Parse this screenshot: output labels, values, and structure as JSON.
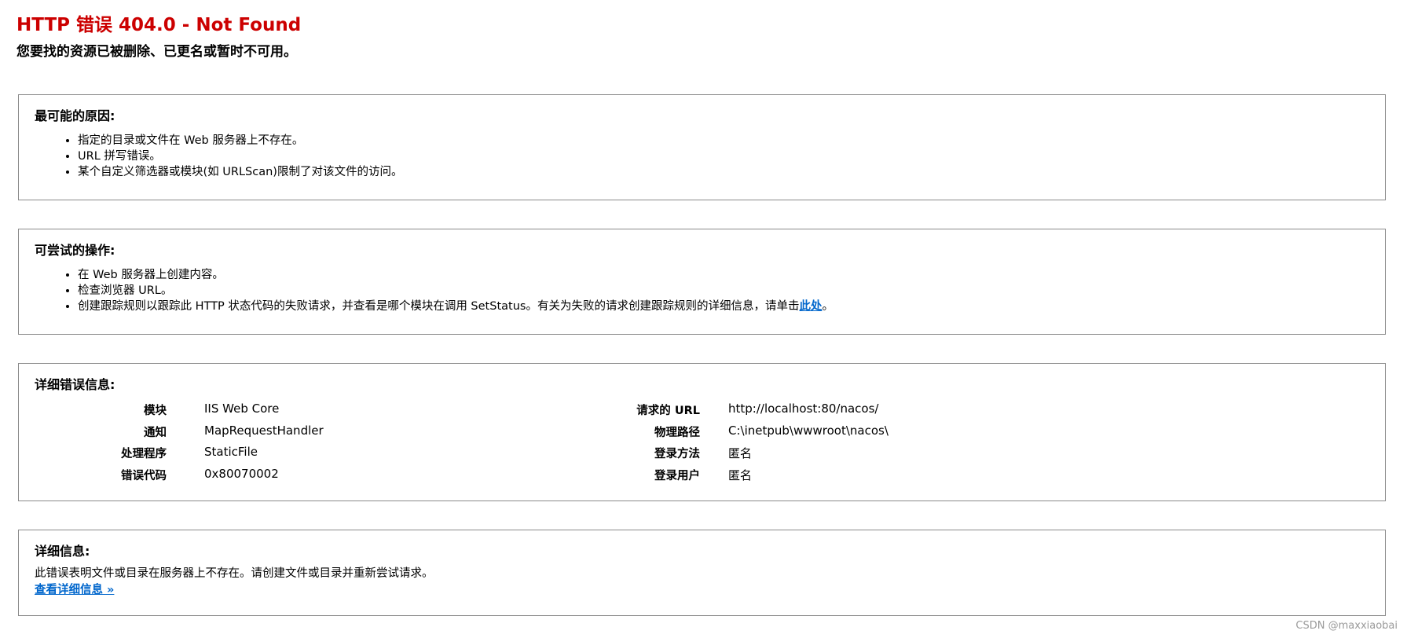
{
  "header": {
    "title": "HTTP 错误 404.0 - Not Found",
    "subtitle": "您要找的资源已被删除、已更名或暂时不可用。"
  },
  "causes": {
    "heading": "最可能的原因:",
    "items": [
      "指定的目录或文件在 Web 服务器上不存在。",
      "URL 拼写错误。",
      "某个自定义筛选器或模块(如 URLScan)限制了对该文件的访问。"
    ]
  },
  "actions": {
    "heading": "可尝试的操作:",
    "items": [
      "在 Web 服务器上创建内容。",
      "检查浏览器 URL。"
    ],
    "last_item_text": "创建跟踪规则以跟踪此 HTTP 状态代码的失败请求，并查看是哪个模块在调用 SetStatus。有关为失败的请求创建跟踪规则的详细信息，请单击",
    "last_item_link": "此处",
    "last_item_end": "。"
  },
  "details": {
    "heading": "详细错误信息:",
    "left": [
      {
        "label": "模块",
        "value": "IIS Web Core"
      },
      {
        "label": "通知",
        "value": "MapRequestHandler"
      },
      {
        "label": "处理程序",
        "value": "StaticFile"
      },
      {
        "label": "错误代码",
        "value": "0x80070002"
      }
    ],
    "right": [
      {
        "label": "请求的 URL",
        "value": "http://localhost:80/nacos/"
      },
      {
        "label": "物理路径",
        "value": "C:\\inetpub\\wwwroot\\nacos\\"
      },
      {
        "label": "登录方法",
        "value": "匿名"
      },
      {
        "label": "登录用户",
        "value": "匿名"
      }
    ]
  },
  "more_info": {
    "heading": "详细信息:",
    "text": "此错误表明文件或目录在服务器上不存在。请创建文件或目录并重新尝试请求。",
    "link": "查看详细信息 »"
  },
  "watermark": "CSDN @maxxiaobai",
  "colors": {
    "title_red": "#CC0000",
    "link_blue": "#0066CC",
    "border_gray": "#8a8a8a"
  }
}
